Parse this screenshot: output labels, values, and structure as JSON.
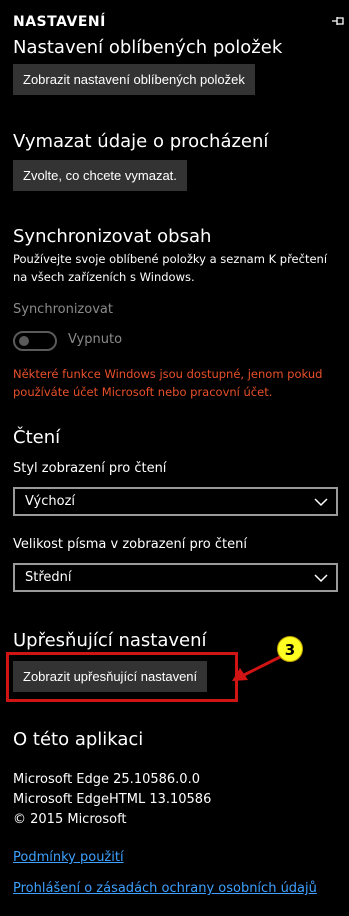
{
  "header": {
    "title": "NASTAVENÍ"
  },
  "favorites": {
    "title": "Nastavení oblíbených položek",
    "button": "Zobrazit nastavení oblíbených položek"
  },
  "clear_data": {
    "title": "Vymazat údaje o procházení",
    "button": "Zvolte, co chcete vymazat."
  },
  "sync": {
    "title": "Synchronizovat obsah",
    "description": "Používejte svoje oblíbené položky a seznam K přečtení na všech zařízeních s Windows.",
    "toggle_label": "Synchronizovat",
    "toggle_state": "Vypnuto",
    "warning": "Některé funkce Windows jsou dostupné, jenom pokud používáte účet Microsoft nebo pracovní účet."
  },
  "reading": {
    "title": "Čtení",
    "style_label": "Styl zobrazení pro čtení",
    "style_value": "Výchozí",
    "font_label": "Velikost písma v zobrazení pro čtení",
    "font_value": "Střední"
  },
  "advanced": {
    "title": "Upřesňující nastavení",
    "button": "Zobrazit upřesňující nastavení"
  },
  "about": {
    "title": "O této aplikaci",
    "line1": "Microsoft Edge 25.10586.0.0",
    "line2": "Microsoft EdgeHTML 13.10586",
    "line3": "© 2015 Microsoft",
    "terms_link": "Podmínky použití",
    "privacy_link": "Prohlášení o zásadách ochrany osobních údajů"
  },
  "annotation": {
    "step": "3"
  },
  "colors": {
    "background": "#000000",
    "button": "#333333",
    "warning": "#e8502a",
    "link": "#3ea1ff",
    "highlight": "#d01414",
    "badge": "#ffff22"
  },
  "icons": {
    "pin": "pin-icon",
    "dropdown": "chevron-down-icon"
  }
}
